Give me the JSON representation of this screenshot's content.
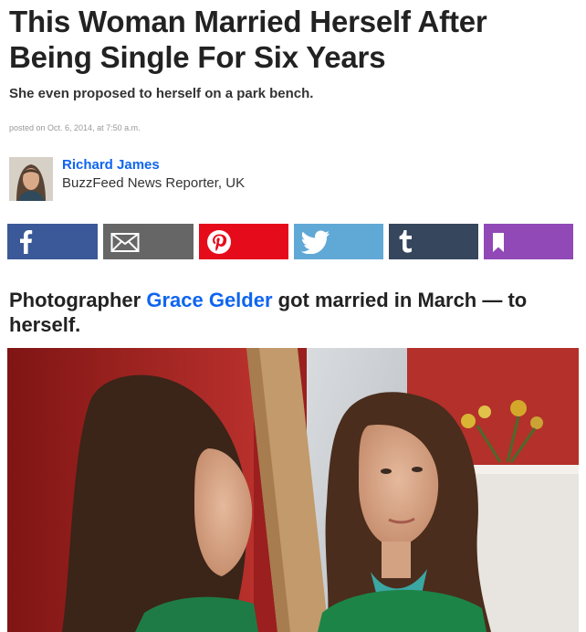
{
  "article": {
    "headline": "This Woman Married Herself After Being Single For Six Years",
    "dek": "She even proposed to herself on a park bench.",
    "posted": "posted on Oct. 6, 2014, at 7:50 a.m."
  },
  "author": {
    "name": "Richard James",
    "title": "BuzzFeed News Reporter, UK"
  },
  "share_buttons": [
    {
      "icon": "facebook-icon",
      "color": "#3b5998"
    },
    {
      "icon": "email-icon",
      "color": "#666666"
    },
    {
      "icon": "pinterest-icon",
      "color": "#e60b1b"
    },
    {
      "icon": "twitter-icon",
      "color": "#60a9d6"
    },
    {
      "icon": "tumblr-icon",
      "color": "#36465d"
    },
    {
      "icon": "bookmark-icon",
      "color": "#9149b7"
    }
  ],
  "section": {
    "prefix": "Photographer ",
    "link_text": "Grace Gelder",
    "suffix": " got married in March — to herself."
  },
  "colors": {
    "link": "#0f65ef",
    "text": "#222222"
  }
}
